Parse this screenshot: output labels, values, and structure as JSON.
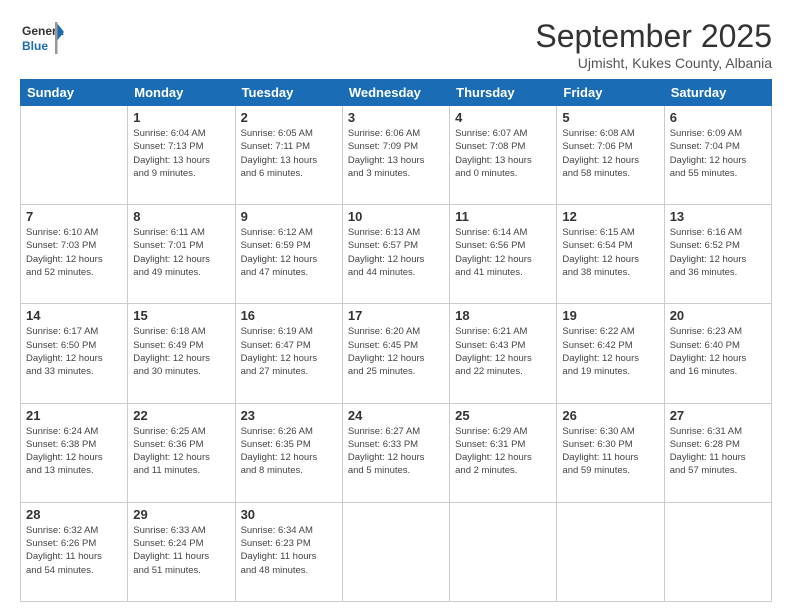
{
  "logo": {
    "line1": "General",
    "line2": "Blue"
  },
  "title": "September 2025",
  "subtitle": "Ujmisht, Kukes County, Albania",
  "days_header": [
    "Sunday",
    "Monday",
    "Tuesday",
    "Wednesday",
    "Thursday",
    "Friday",
    "Saturday"
  ],
  "weeks": [
    [
      {
        "day": "",
        "info": ""
      },
      {
        "day": "1",
        "info": "Sunrise: 6:04 AM\nSunset: 7:13 PM\nDaylight: 13 hours\nand 9 minutes."
      },
      {
        "day": "2",
        "info": "Sunrise: 6:05 AM\nSunset: 7:11 PM\nDaylight: 13 hours\nand 6 minutes."
      },
      {
        "day": "3",
        "info": "Sunrise: 6:06 AM\nSunset: 7:09 PM\nDaylight: 13 hours\nand 3 minutes."
      },
      {
        "day": "4",
        "info": "Sunrise: 6:07 AM\nSunset: 7:08 PM\nDaylight: 13 hours\nand 0 minutes."
      },
      {
        "day": "5",
        "info": "Sunrise: 6:08 AM\nSunset: 7:06 PM\nDaylight: 12 hours\nand 58 minutes."
      },
      {
        "day": "6",
        "info": "Sunrise: 6:09 AM\nSunset: 7:04 PM\nDaylight: 12 hours\nand 55 minutes."
      }
    ],
    [
      {
        "day": "7",
        "info": "Sunrise: 6:10 AM\nSunset: 7:03 PM\nDaylight: 12 hours\nand 52 minutes."
      },
      {
        "day": "8",
        "info": "Sunrise: 6:11 AM\nSunset: 7:01 PM\nDaylight: 12 hours\nand 49 minutes."
      },
      {
        "day": "9",
        "info": "Sunrise: 6:12 AM\nSunset: 6:59 PM\nDaylight: 12 hours\nand 47 minutes."
      },
      {
        "day": "10",
        "info": "Sunrise: 6:13 AM\nSunset: 6:57 PM\nDaylight: 12 hours\nand 44 minutes."
      },
      {
        "day": "11",
        "info": "Sunrise: 6:14 AM\nSunset: 6:56 PM\nDaylight: 12 hours\nand 41 minutes."
      },
      {
        "day": "12",
        "info": "Sunrise: 6:15 AM\nSunset: 6:54 PM\nDaylight: 12 hours\nand 38 minutes."
      },
      {
        "day": "13",
        "info": "Sunrise: 6:16 AM\nSunset: 6:52 PM\nDaylight: 12 hours\nand 36 minutes."
      }
    ],
    [
      {
        "day": "14",
        "info": "Sunrise: 6:17 AM\nSunset: 6:50 PM\nDaylight: 12 hours\nand 33 minutes."
      },
      {
        "day": "15",
        "info": "Sunrise: 6:18 AM\nSunset: 6:49 PM\nDaylight: 12 hours\nand 30 minutes."
      },
      {
        "day": "16",
        "info": "Sunrise: 6:19 AM\nSunset: 6:47 PM\nDaylight: 12 hours\nand 27 minutes."
      },
      {
        "day": "17",
        "info": "Sunrise: 6:20 AM\nSunset: 6:45 PM\nDaylight: 12 hours\nand 25 minutes."
      },
      {
        "day": "18",
        "info": "Sunrise: 6:21 AM\nSunset: 6:43 PM\nDaylight: 12 hours\nand 22 minutes."
      },
      {
        "day": "19",
        "info": "Sunrise: 6:22 AM\nSunset: 6:42 PM\nDaylight: 12 hours\nand 19 minutes."
      },
      {
        "day": "20",
        "info": "Sunrise: 6:23 AM\nSunset: 6:40 PM\nDaylight: 12 hours\nand 16 minutes."
      }
    ],
    [
      {
        "day": "21",
        "info": "Sunrise: 6:24 AM\nSunset: 6:38 PM\nDaylight: 12 hours\nand 13 minutes."
      },
      {
        "day": "22",
        "info": "Sunrise: 6:25 AM\nSunset: 6:36 PM\nDaylight: 12 hours\nand 11 minutes."
      },
      {
        "day": "23",
        "info": "Sunrise: 6:26 AM\nSunset: 6:35 PM\nDaylight: 12 hours\nand 8 minutes."
      },
      {
        "day": "24",
        "info": "Sunrise: 6:27 AM\nSunset: 6:33 PM\nDaylight: 12 hours\nand 5 minutes."
      },
      {
        "day": "25",
        "info": "Sunrise: 6:29 AM\nSunset: 6:31 PM\nDaylight: 12 hours\nand 2 minutes."
      },
      {
        "day": "26",
        "info": "Sunrise: 6:30 AM\nSunset: 6:30 PM\nDaylight: 11 hours\nand 59 minutes."
      },
      {
        "day": "27",
        "info": "Sunrise: 6:31 AM\nSunset: 6:28 PM\nDaylight: 11 hours\nand 57 minutes."
      }
    ],
    [
      {
        "day": "28",
        "info": "Sunrise: 6:32 AM\nSunset: 6:26 PM\nDaylight: 11 hours\nand 54 minutes."
      },
      {
        "day": "29",
        "info": "Sunrise: 6:33 AM\nSunset: 6:24 PM\nDaylight: 11 hours\nand 51 minutes."
      },
      {
        "day": "30",
        "info": "Sunrise: 6:34 AM\nSunset: 6:23 PM\nDaylight: 11 hours\nand 48 minutes."
      },
      {
        "day": "",
        "info": ""
      },
      {
        "day": "",
        "info": ""
      },
      {
        "day": "",
        "info": ""
      },
      {
        "day": "",
        "info": ""
      }
    ]
  ]
}
